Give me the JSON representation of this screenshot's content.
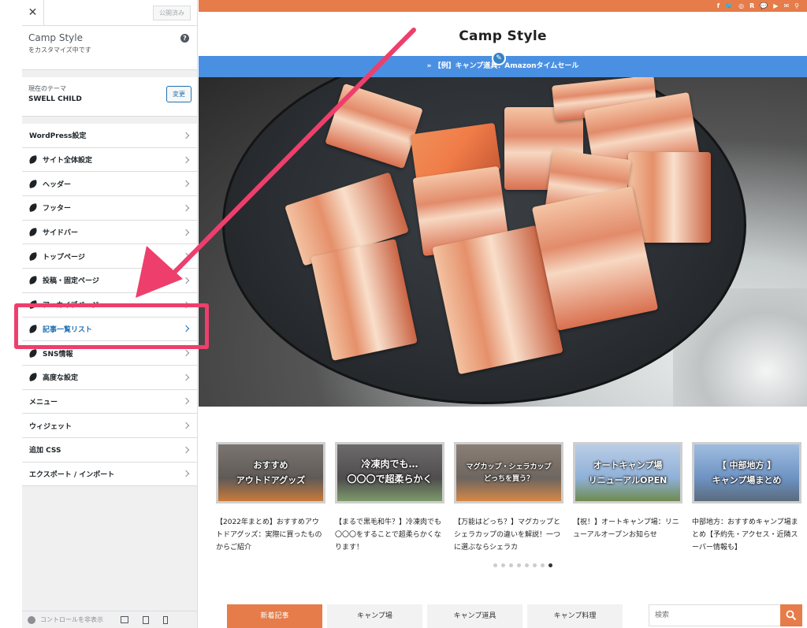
{
  "customizer": {
    "close_label": "✕",
    "publish_label": "公開済み",
    "site_title": "Camp Style",
    "customizing_text": "をカスタマイズ中です",
    "help_label": "?",
    "theme_label": "現在のテーマ",
    "theme_name": "SWELL CHILD",
    "change_label": "変更",
    "menu_items": [
      {
        "label": "WordPress設定",
        "icon": "none"
      },
      {
        "label": "サイト全体設定",
        "icon": "swell-leaf-icon"
      },
      {
        "label": "ヘッダー",
        "icon": "swell-leaf-icon"
      },
      {
        "label": "フッター",
        "icon": "swell-leaf-icon"
      },
      {
        "label": "サイドバー",
        "icon": "swell-leaf-icon"
      },
      {
        "label": "トップページ",
        "icon": "swell-leaf-icon"
      },
      {
        "label": "投稿・固定ページ",
        "icon": "swell-leaf-icon"
      },
      {
        "label": "アーカイブページ",
        "icon": "swell-leaf-icon"
      },
      {
        "label": "記事一覧リスト",
        "icon": "swell-leaf-icon",
        "highlighted": true
      },
      {
        "label": "SNS情報",
        "icon": "swell-leaf-icon"
      },
      {
        "label": "高度な設定",
        "icon": "swell-leaf-icon"
      },
      {
        "label": "メニュー",
        "icon": "none"
      },
      {
        "label": "ウィジェット",
        "icon": "none"
      },
      {
        "label": "追加 CSS",
        "icon": "none"
      },
      {
        "label": "エクスポート / インポート",
        "icon": "none"
      }
    ],
    "hide_controls_label": "コントロールを非表示",
    "highlight_color": "#ee3f6c"
  },
  "preview": {
    "accent_color": "#e57c4a",
    "info_color": "#4a90e2",
    "social_icons": [
      "f",
      "facebook-icon",
      "twitter-icon",
      "instagram-icon",
      "R",
      "line-icon",
      "youtube-icon",
      "mail-icon",
      "search-icon"
    ],
    "social_labels": [
      "f",
      "🐦",
      "◎",
      "R",
      "💬",
      "▶",
      "✉",
      "⚲"
    ],
    "logo": "Camp Style",
    "info_bar": "» 【例】キャンプ道具：Amazonタイムセール",
    "posts": [
      {
        "thumb_text": "おすすめ\nアウトドアグッズ",
        "title": "【2022年まとめ】おすすめアウトドアグッズ：実際に買ったものからご紹介"
      },
      {
        "thumb_text": "冷凍肉でも…\n〇〇〇で超柔らかく",
        "title": "【まるで黒毛和牛？】冷凍肉でも〇〇〇をすることで超柔らかくなります！"
      },
      {
        "thumb_text": "マグカップ・シェラカップ\nどっちを買う？",
        "title": "【万能はどっち？】マグカップとシェラカップの違いを解説！一つに選ぶならシェラカ"
      },
      {
        "thumb_text": "オートキャンプ場\nリニューアルOPEN",
        "title": "【祝！】オートキャンプ場：リニューアルオープンお知らせ"
      },
      {
        "thumb_text": "【 中部地方 】\nキャンプ場まとめ",
        "title": "中部地方：おすすめキャンプ場まとめ【予約先・アクセス・近隣スーパー情報も】"
      }
    ],
    "slider_dots": 8,
    "slider_active_dot": 8,
    "tabs": [
      "新着記事",
      "キャンプ場",
      "キャンプ道具",
      "キャンプ料理"
    ],
    "active_tab": 1,
    "search_placeholder": "検索"
  }
}
